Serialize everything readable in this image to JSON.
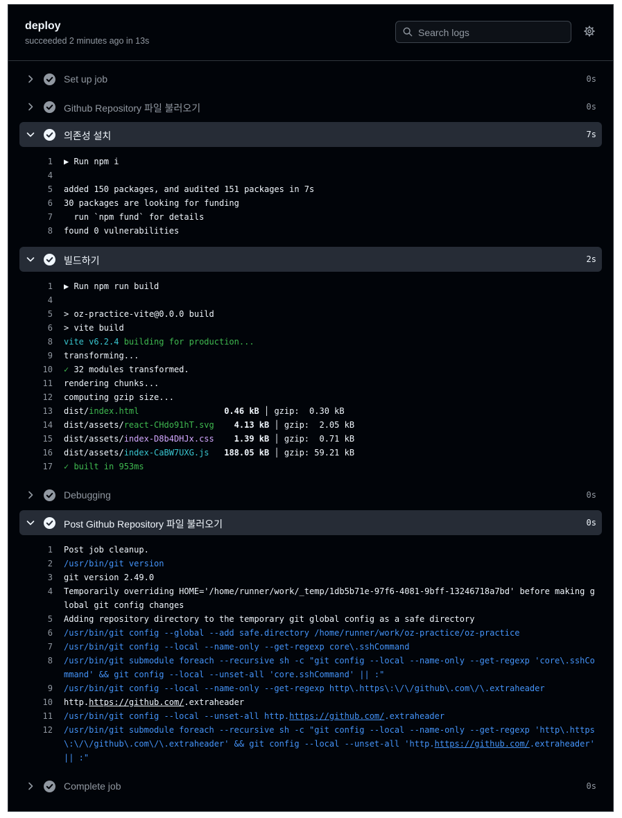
{
  "job": {
    "title": "deploy",
    "subtitle": "succeeded 2 minutes ago in 13s"
  },
  "search": {
    "placeholder": "Search logs"
  },
  "steps": {
    "setup": {
      "name": "Set up job",
      "duration": "0s"
    },
    "checkout": {
      "name": "Github Repository 파일 불러오기",
      "duration": "0s"
    },
    "install": {
      "name": "의존성 설치",
      "duration": "7s"
    },
    "build": {
      "name": "빌드하기",
      "duration": "2s"
    },
    "debug": {
      "name": "Debugging",
      "duration": "0s"
    },
    "post": {
      "name": "Post Github Repository 파일 불러오기",
      "duration": "0s"
    },
    "complete": {
      "name": "Complete job",
      "duration": "0s"
    }
  },
  "install_log": [
    {
      "n": "1",
      "t": "▶ Run npm i"
    },
    {
      "n": "4",
      "t": ""
    },
    {
      "n": "5",
      "t": "added 150 packages, and audited 151 packages in 7s"
    },
    {
      "n": "6",
      "t": "30 packages are looking for funding"
    },
    {
      "n": "7",
      "t": "  run `npm fund` for details"
    },
    {
      "n": "8",
      "t": "found 0 vulnerabilities"
    }
  ],
  "build_log": {
    "l1": {
      "n": "1",
      "t": "▶ Run npm run build"
    },
    "l4": {
      "n": "4",
      "t": ""
    },
    "l5": {
      "n": "5",
      "t": "> oz-practice-vite@0.0.0 build"
    },
    "l6": {
      "n": "6",
      "t": "> vite build"
    },
    "l8": {
      "n": "8",
      "a": "vite v6.2.4",
      "b": " building for production..."
    },
    "l9": {
      "n": "9",
      "t": "transforming..."
    },
    "l10": {
      "n": "10",
      "a": "✓",
      "b": " 32 modules transformed."
    },
    "l11": {
      "n": "11",
      "t": "rendering chunks..."
    },
    "l12": {
      "n": "12",
      "t": "computing gzip size..."
    },
    "l13": {
      "n": "13",
      "dir": "dist/",
      "file": "index.html",
      "pad": "                 ",
      "size": "0.46 kB",
      "gz": " │ gzip:  0.30 kB"
    },
    "l14": {
      "n": "14",
      "dir": "dist/assets/",
      "file": "react-CHdo91hT.svg",
      "pad": "    ",
      "size": "4.13 kB",
      "gz": " │ gzip:  2.05 kB"
    },
    "l15": {
      "n": "15",
      "dir": "dist/assets/",
      "file": "index-D8b4DHJx.css",
      "pad": "    ",
      "size": "1.39 kB",
      "gz": " │ gzip:  0.71 kB"
    },
    "l16": {
      "n": "16",
      "dir": "dist/assets/",
      "file": "index-CaBW7UXG.js",
      "pad": "   ",
      "size": "188.05 kB",
      "gz": " │ gzip: 59.21 kB"
    },
    "l17": {
      "n": "17",
      "t": "✓ built in 953ms"
    }
  },
  "post_log": {
    "l1": {
      "n": "1",
      "t": "Post job cleanup."
    },
    "l2": {
      "n": "2",
      "t": "/usr/bin/git version"
    },
    "l3": {
      "n": "3",
      "t": "git version 2.49.0"
    },
    "l4": {
      "n": "4",
      "t": "Temporarily overriding HOME='/home/runner/work/_temp/1db5b71e-97f6-4081-9bff-13246718a7bd' before making global git config changes"
    },
    "l5": {
      "n": "5",
      "t": "Adding repository directory to the temporary git global config as a safe directory"
    },
    "l6": {
      "n": "6",
      "t": "/usr/bin/git config --global --add safe.directory /home/runner/work/oz-practice/oz-practice"
    },
    "l7": {
      "n": "7",
      "t": "/usr/bin/git config --local --name-only --get-regexp core\\.sshCommand"
    },
    "l8": {
      "n": "8",
      "t": "/usr/bin/git submodule foreach --recursive sh -c \"git config --local --name-only --get-regexp 'core\\.sshCommand' && git config --local --unset-all 'core.sshCommand' || :\""
    },
    "l9": {
      "n": "9",
      "t": "/usr/bin/git config --local --name-only --get-regexp http\\.https\\:\\/\\/github\\.com\\/\\.extraheader"
    },
    "l10": {
      "n": "10",
      "a": "http.",
      "url": "https://github.com/",
      "b": ".extraheader"
    },
    "l11": {
      "n": "11",
      "a": "/usr/bin/git config --local --unset-all http.",
      "url": "https://github.com/",
      "b": ".extraheader"
    },
    "l12": {
      "n": "12",
      "a": "/usr/bin/git submodule foreach --recursive sh -c \"git config --local --name-only --get-regexp 'http\\.https\\:\\/\\/github\\.com\\/\\.extraheader' && git config --local --unset-all 'http.",
      "url": "https://github.com/",
      "b": ".extraheader' || :\""
    }
  },
  "colors": {
    "background": "#010409",
    "expanded_row": "#262c36",
    "command_blue": "#4493f8",
    "success_green": "#3fb950",
    "accent_magenta": "#d2a8ff",
    "accent_cyan": "#39c5cf"
  }
}
